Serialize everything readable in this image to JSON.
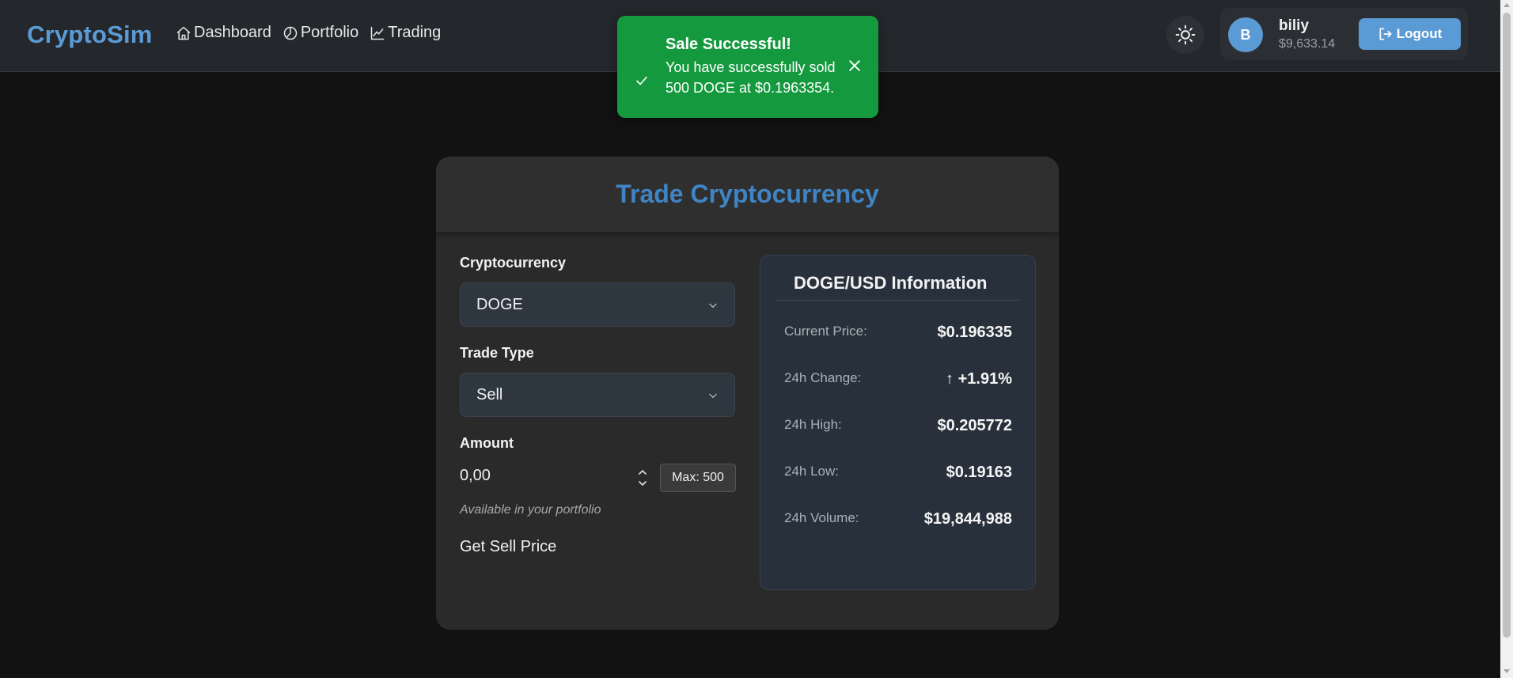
{
  "brand": "CryptoSim",
  "nav": [
    {
      "label": "Dashboard",
      "icon": "home-icon"
    },
    {
      "label": "Portfolio",
      "icon": "pie-chart-icon"
    },
    {
      "label": "Trading",
      "icon": "trending-up-icon"
    }
  ],
  "theme_toggle_icon": "sun-icon",
  "user": {
    "avatar_initial": "B",
    "name": "biliy",
    "balance": "$9,633.14"
  },
  "logout": {
    "label": "Logout",
    "icon": "logout-icon"
  },
  "toast": {
    "title": "Sale Successful!",
    "message": "You have successfully sold 500 DOGE at $0.1963354.",
    "icon": "check-icon",
    "close_icon": "close-icon",
    "color": "#15993f"
  },
  "trade": {
    "title": "Trade Cryptocurrency",
    "crypto_label": "Cryptocurrency",
    "crypto_value": "DOGE",
    "type_label": "Trade Type",
    "type_value": "Sell",
    "amount_label": "Amount",
    "amount_value": "0,00",
    "max_label": "Max: 500",
    "hint": "Available in your portfolio",
    "action_label": "Get Sell Price"
  },
  "info": {
    "title": "DOGE/USD Information",
    "rows": [
      {
        "label": "Current Price:",
        "value": "$0.196335"
      },
      {
        "label": "24h Change:",
        "value": "↑ +1.91%"
      },
      {
        "label": "24h High:",
        "value": "$0.205772"
      },
      {
        "label": "24h Low:",
        "value": "$0.19163"
      },
      {
        "label": "24h Volume:",
        "value": "$19,844,988"
      }
    ]
  },
  "colors": {
    "accent": "#5b9bd5",
    "title_blue": "#3f84c4",
    "success": "#15993f"
  }
}
